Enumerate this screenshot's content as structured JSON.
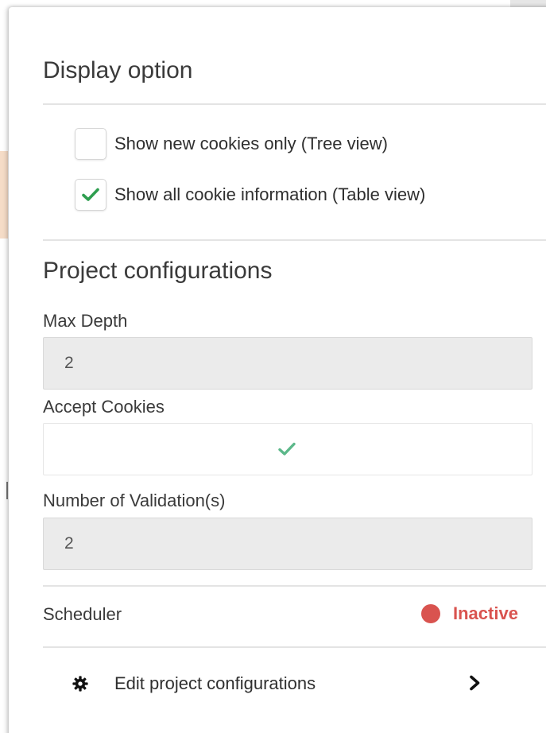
{
  "display_option": {
    "title": "Display option",
    "options": [
      {
        "label": "Show new cookies only (Tree view)",
        "checked": false
      },
      {
        "label": "Show all cookie information (Table view)",
        "checked": true
      }
    ]
  },
  "project_configurations": {
    "title": "Project configurations",
    "max_depth": {
      "label": "Max Depth",
      "value": "2"
    },
    "accept_cookies": {
      "label": "Accept Cookies",
      "checked": true
    },
    "validations": {
      "label": "Number of Validation(s)",
      "value": "2"
    },
    "scheduler": {
      "label": "Scheduler",
      "status": "Inactive",
      "status_color": "#d9534f"
    },
    "edit": {
      "label": "Edit project configurations",
      "icon": "gear-icon",
      "chevron": "chevron-right-icon"
    }
  },
  "colors": {
    "check_green": "#2e9e4f",
    "accept_check_green": "#5cb88a",
    "inactive_red": "#d9534f"
  }
}
